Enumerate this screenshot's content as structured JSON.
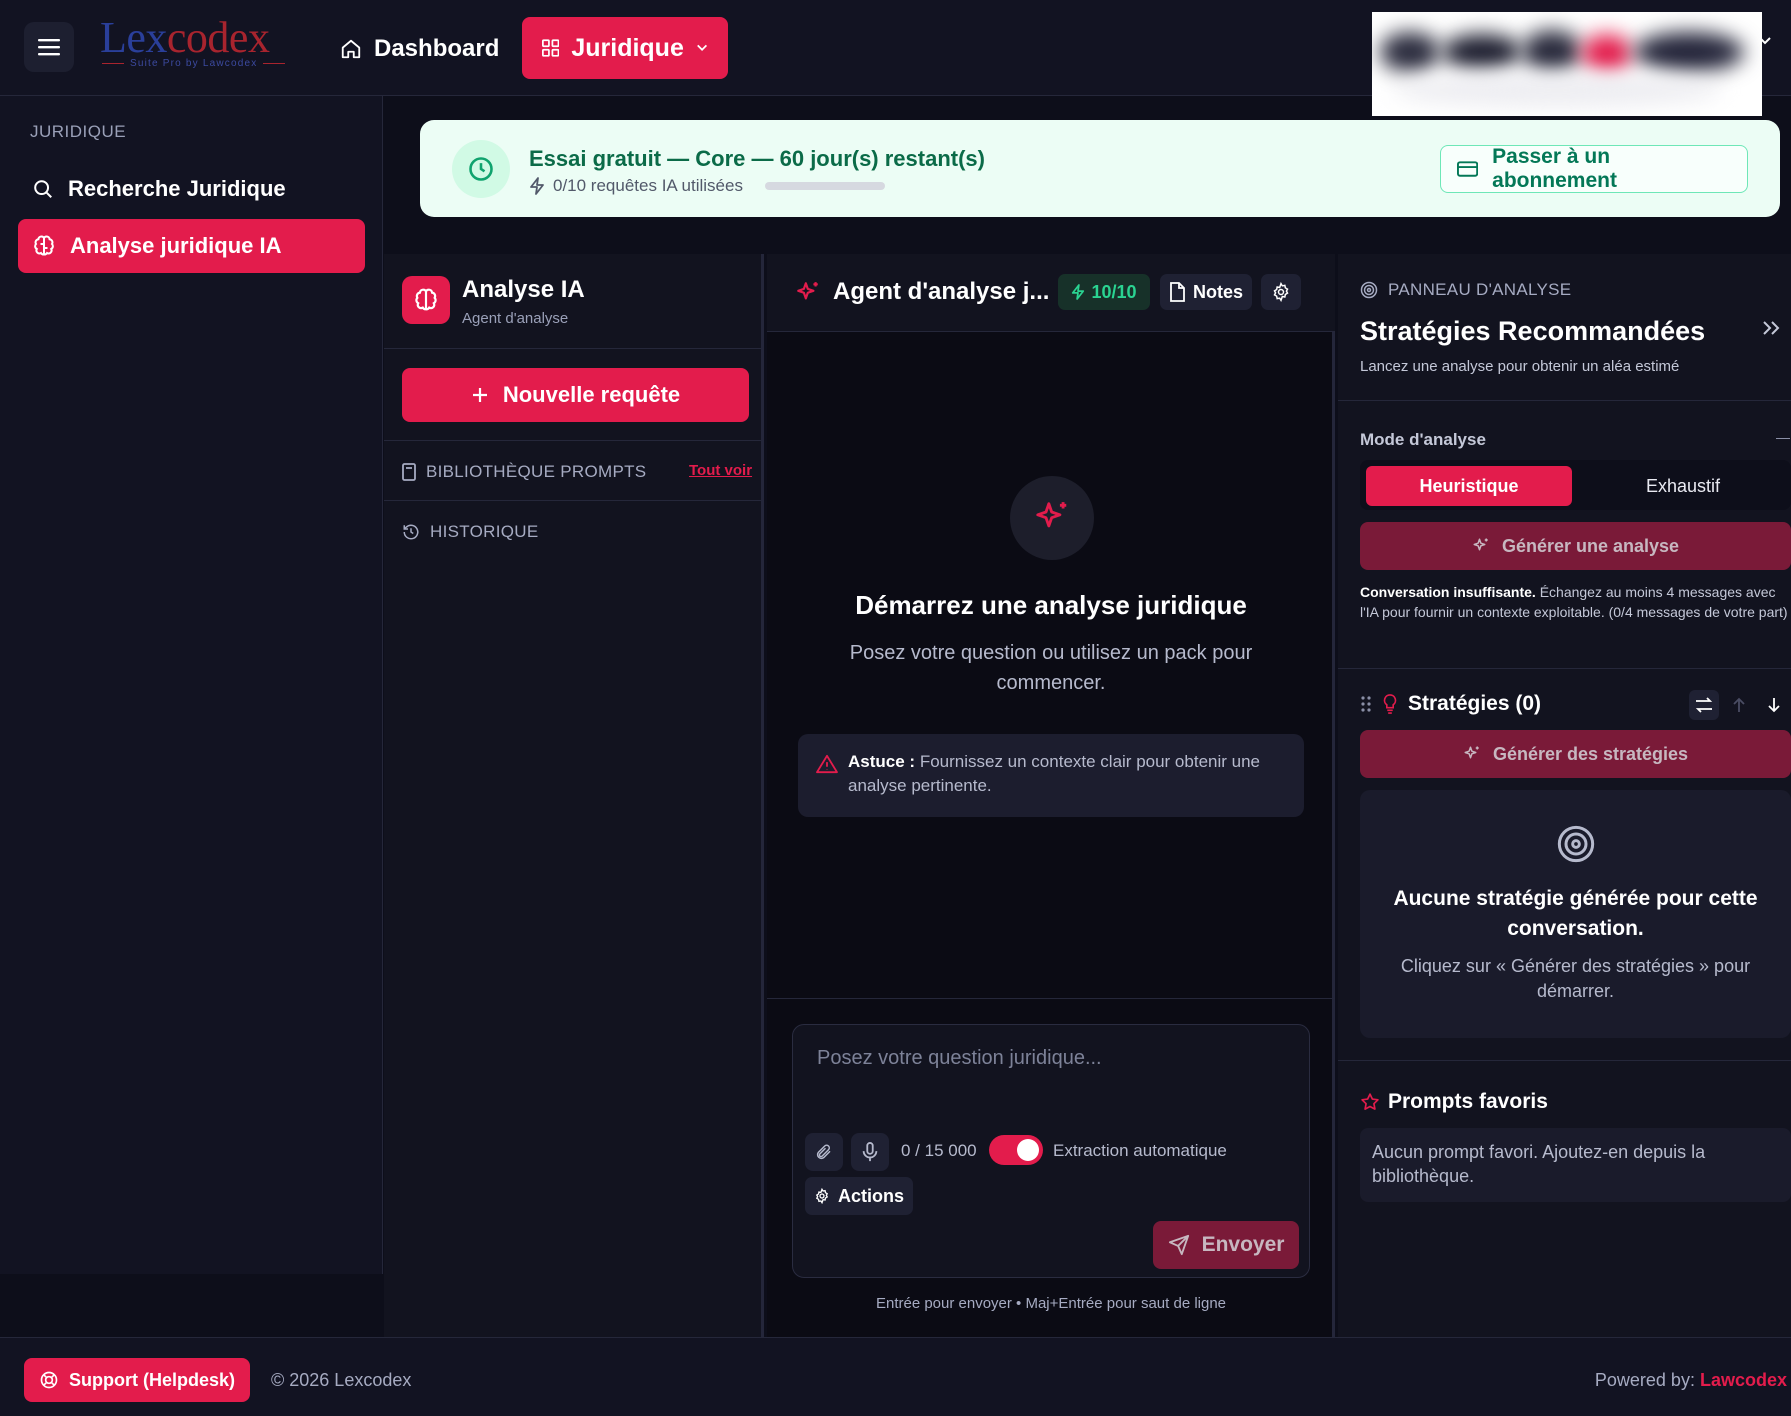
{
  "header": {
    "logo": {
      "text_left": "Lex",
      "text_right": "codex",
      "tagline": "Suite Pro by Lawcodex"
    },
    "nav": {
      "dashboard": "Dashboard",
      "juridique": "Juridique"
    }
  },
  "sidebar": {
    "section": "JURIDIQUE",
    "items": [
      {
        "label": "Recherche Juridique",
        "icon": "search-icon",
        "active": false
      },
      {
        "label": "Analyse juridique IA",
        "icon": "brain-icon",
        "active": true
      }
    ]
  },
  "trial": {
    "title": "Essai gratuit — Core — 60 jour(s) restant(s)",
    "usage": "0/10 requêtes IA utilisées",
    "usage_fraction": 0.0,
    "upgrade_label": "Passer à un abonnement"
  },
  "analysis_panel": {
    "title": "Analyse IA",
    "subtitle": "Agent d'analyse",
    "new_request": "Nouvelle requête",
    "library": "BIBLIOTHÈQUE PROMPTS",
    "see_all": "Tout voir",
    "history": "HISTORIQUE"
  },
  "chat": {
    "title": "Agent d'analyse j...",
    "credits": "10/10",
    "notes": "Notes",
    "empty_title": "Démarrez une analyse juridique",
    "empty_sub": "Posez votre question ou utilisez un pack pour commencer.",
    "tip_label": "Astuce :",
    "tip_text": "Fournissez un contexte clair pour obtenir une analyse pertinente.",
    "input_placeholder": "Posez votre question juridique...",
    "char_count": "0 / 15 000",
    "auto_extract_label": "Extraction automatique",
    "auto_extract_on": true,
    "actions": "Actions",
    "send": "Envoyer",
    "hint": "Entrée pour envoyer • Maj+Entrée pour saut de ligne"
  },
  "strategy_panel": {
    "eyebrow": "PANNEAU D'ANALYSE",
    "title": "Stratégies Recommandées",
    "subtitle": "Lancez une analyse pour obtenir un aléa estimé",
    "mode_label": "Mode d'analyse",
    "modes": [
      "Heuristique",
      "Exhaustif"
    ],
    "mode_selected": "Heuristique",
    "generate_analysis": "Générer une analyse",
    "warning_bold": "Conversation insuffisante.",
    "warning_text": "Échangez au moins 4 messages avec l'IA pour fournir un contexte exploitable. (0/4 messages de votre part)",
    "strategies_title": "Stratégies (0)",
    "generate_strategies": "Générer des stratégies",
    "empty_title": "Aucune stratégie générée pour cette conversation.",
    "empty_sub": "Cliquez sur « Générer des stratégies » pour démarrer.",
    "favorites_title": "Prompts favoris",
    "favorites_empty": "Aucun prompt favori. Ajoutez-en depuis la bibliothèque."
  },
  "footer": {
    "support": "Support (Helpdesk)",
    "copyright": "© 2026 Lexcodex",
    "powered_prefix": "Powered by:",
    "powered_brand": "Lawcodex"
  },
  "colors": {
    "accent": "#e31c4c",
    "accent_disabled": "#7a1a38",
    "background": "#0d0e1a",
    "panel": "#12131f",
    "trial_bg": "#ecfdf5",
    "trial_text": "#0b6b48",
    "credit_green": "#2ad391"
  }
}
